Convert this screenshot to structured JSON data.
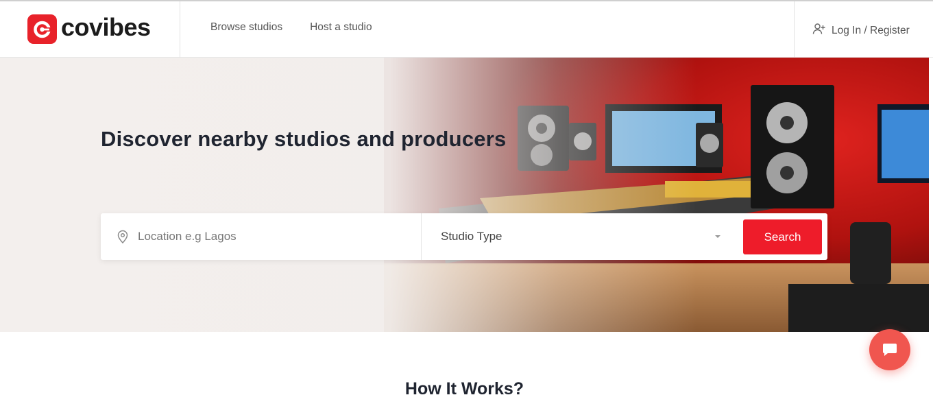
{
  "brand": {
    "name": "covibes",
    "logo_icon": "covibes-logo-icon",
    "color": "#e8222a"
  },
  "nav": {
    "items": [
      {
        "label": "Browse studios"
      },
      {
        "label": "Host a studio"
      }
    ]
  },
  "auth": {
    "label": "Log In / Register",
    "icon": "user-plus-icon"
  },
  "hero": {
    "title": "Discover nearby studios and producers",
    "search": {
      "location_placeholder": "Location e.g Lagos",
      "location_value": "",
      "location_icon": "map-pin-icon",
      "studio_type_label": "Studio Type",
      "studio_type_icon": "caret-down-icon",
      "button_label": "Search",
      "button_color": "#ee1c2a"
    }
  },
  "how_it_works": {
    "title": "How It Works?"
  },
  "chat": {
    "icon": "chat-bubble-icon",
    "color": "#f0564f"
  }
}
